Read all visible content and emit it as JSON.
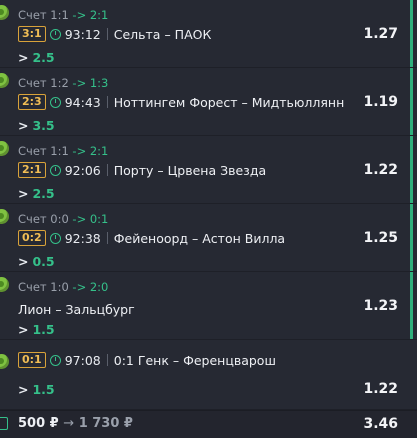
{
  "bets": [
    {
      "score_prefix": "Счет 1:1",
      "score_new": "-> 2:1",
      "live_score": "3:1",
      "time": "93:12",
      "teams": "Сельта – ПАОК",
      "outcome": "2.5",
      "odds": "1.27"
    },
    {
      "score_prefix": "Счет 1:2",
      "score_new": "-> 1:3",
      "live_score": "2:3",
      "time": "94:43",
      "teams": "Ноттингем Форест – Мидтьюллянн",
      "outcome": "3.5",
      "odds": "1.19"
    },
    {
      "score_prefix": "Счет 1:1",
      "score_new": "-> 2:1",
      "live_score": "2:1",
      "time": "92:06",
      "teams": "Порту – Црвена Звезда",
      "outcome": "2.5",
      "odds": "1.22"
    },
    {
      "score_prefix": "Счет 0:0",
      "score_new": "-> 0:1",
      "live_score": "0:2",
      "time": "92:38",
      "teams": "Фейеноорд – Астон Вилла",
      "outcome": "0.5",
      "odds": "1.25"
    },
    {
      "score_prefix": "Счет 1:0",
      "score_new": "-> 2:0",
      "teams": "Лион – Зальцбург",
      "outcome": "1.5",
      "odds": "1.23"
    },
    {
      "live_score": "0:1",
      "time": "97:08",
      "teams": "0:1 Генк – Ференцварош",
      "outcome": "1.5",
      "odds": "1.22"
    }
  ],
  "outcome_prefix": ">",
  "footer": {
    "stake": "500 ₽",
    "arrow": "→",
    "win": "1 730 ₽",
    "total_odds": "3.46"
  },
  "colors": {
    "accent": "#35c08a",
    "score_badge": "#f0bd55",
    "background": "#262933"
  }
}
